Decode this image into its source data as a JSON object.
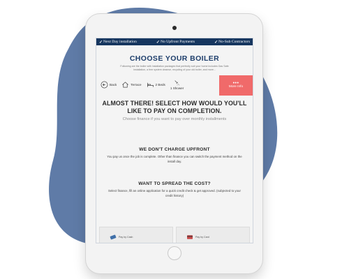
{
  "colors": {
    "blob": "#5f7ba7",
    "banner": "#16365f",
    "title": "#1e3e6b",
    "accent": "#f06a6a"
  },
  "banner": {
    "items": [
      "Next Day installation",
      "No Upfront Payments",
      "No-Sub Contractors"
    ]
  },
  "page": {
    "title": "CHOOSE YOUR BOILER",
    "subtitle": "Following are the boiler with installation packages that perfectly suit your home includes Gas Safe installation, a free system cleanse, recycling of your old boiler, and more..."
  },
  "steps": {
    "back": "Back",
    "property": "Terrace",
    "bedrooms": "2 Beds",
    "shower": "1 Shower",
    "more_info": "More Info"
  },
  "main": {
    "heading": "ALMOST THERE! SELECT HOW WOULD YOU'LL LIKE TO PAY ON COMPLETION.",
    "subheading": "Choose finance if you want to pay over monthly installments"
  },
  "sections": {
    "no_charge": {
      "title": "WE DON'T CHARGE UPFRONT",
      "text": "You pay us once the job is complete. Other than finance you can switch the payment method on the install day."
    },
    "spread": {
      "title": "WANT TO SPREAD THE COST?",
      "text": "Select finance, fill an online application for a quick credit check & get approved. (subjected to your credit history)"
    }
  },
  "options": {
    "cash": "Pay by Cash",
    "card": "Pay by Card"
  }
}
